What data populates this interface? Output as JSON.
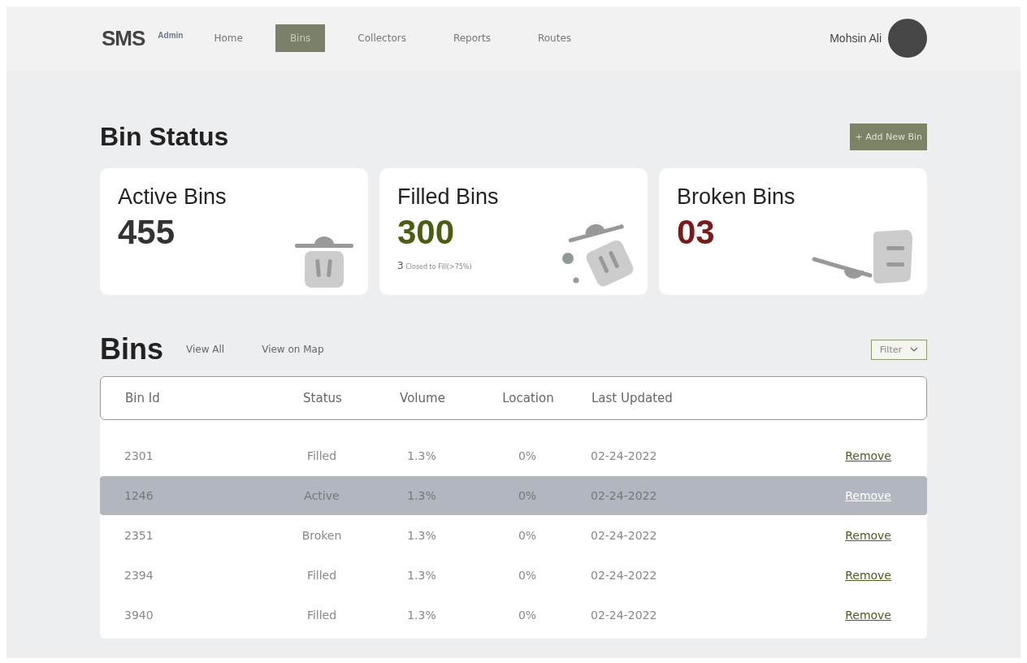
{
  "header": {
    "logo": "SMS",
    "role": "Admin",
    "nav": [
      {
        "label": "Home",
        "selected": false
      },
      {
        "label": "Bins",
        "selected": true
      },
      {
        "label": "Collectors",
        "selected": false
      },
      {
        "label": "Reports",
        "selected": false
      },
      {
        "label": "Routes",
        "selected": false
      }
    ],
    "user": "Mohsin Ali"
  },
  "status": {
    "title": "Bin Status",
    "add_button": {
      "icon": "+",
      "label": "Add New Bin"
    },
    "cards": [
      {
        "kind": "standing",
        "title": "Active Bins",
        "value": "455",
        "color": "#333333"
      },
      {
        "kind": "tipped",
        "title": "Filled Bins",
        "value": "300",
        "color": "#4a5e12",
        "note_count": "3",
        "note": "Closed to Fill(>75%)"
      },
      {
        "kind": "broken",
        "title": "Broken Bins",
        "value": "03",
        "color": "#7a1a1a"
      }
    ]
  },
  "bins": {
    "title": "Bins",
    "links": [
      "View All",
      "View on Map"
    ],
    "filter": "Filter",
    "table": {
      "columns": [
        "Bin Id",
        "Status",
        "Volume",
        "Location",
        "Last Updated"
      ],
      "rows": [
        {
          "cells": [
            "2301",
            "Filled",
            "1.3%",
            "0%",
            "02-24-2022"
          ],
          "action": "Remove",
          "selected": false
        },
        {
          "cells": [
            "1246",
            "Active",
            "1.3%",
            "0%",
            "02-24-2022"
          ],
          "action": "Remove",
          "selected": true
        },
        {
          "cells": [
            "2351",
            "Broken",
            "1.3%",
            "0%",
            "02-24-2022"
          ],
          "action": "Remove",
          "selected": false
        },
        {
          "cells": [
            "2394",
            "Filled",
            "1.3%",
            "0%",
            "02-24-2022"
          ],
          "action": "Remove",
          "selected": false
        },
        {
          "cells": [
            "3940",
            "Filled",
            "1.3%",
            "0%",
            "02-24-2022"
          ],
          "action": "Remove",
          "selected": false
        }
      ]
    }
  }
}
